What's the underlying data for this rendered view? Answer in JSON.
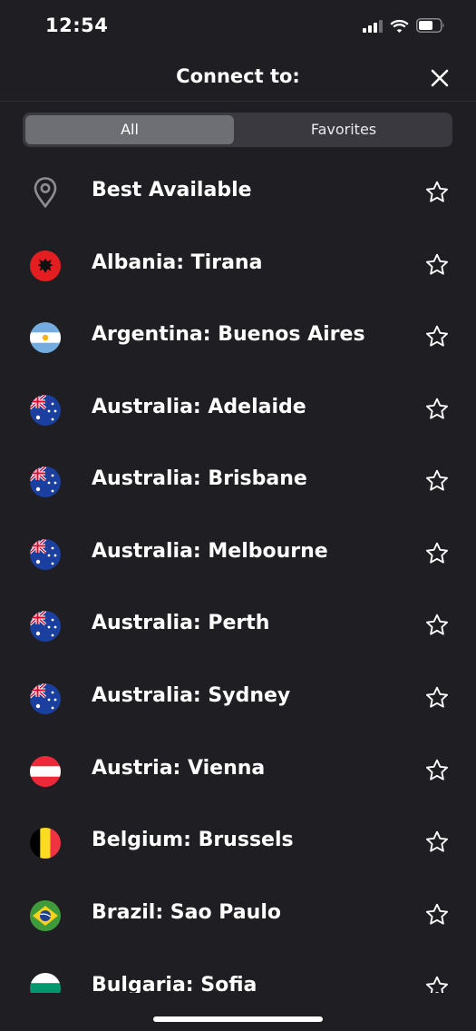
{
  "status_bar": {
    "time": "12:54",
    "icons": [
      "cellular-signal-icon",
      "wifi-icon",
      "battery-icon"
    ]
  },
  "header": {
    "title": "Connect to:",
    "close_icon": "close-icon"
  },
  "tabs": [
    {
      "label": "All",
      "selected": true
    },
    {
      "label": "Favorites",
      "selected": false
    }
  ],
  "colors": {
    "background": "#1f1e22",
    "segment_bg": "#3a393f",
    "segment_active": "#6e6f75",
    "text": "#ffffff"
  },
  "locations": [
    {
      "label": "Best Available",
      "icon": "location-pin-icon"
    },
    {
      "label": "Albania: Tirana",
      "icon": "albania-flag-icon"
    },
    {
      "label": "Argentina: Buenos Aires",
      "icon": "argentina-flag-icon"
    },
    {
      "label": "Australia: Adelaide",
      "icon": "australia-flag-icon"
    },
    {
      "label": "Australia: Brisbane",
      "icon": "australia-flag-icon"
    },
    {
      "label": "Australia: Melbourne",
      "icon": "australia-flag-icon"
    },
    {
      "label": "Australia: Perth",
      "icon": "australia-flag-icon"
    },
    {
      "label": "Australia: Sydney",
      "icon": "australia-flag-icon"
    },
    {
      "label": "Austria: Vienna",
      "icon": "austria-flag-icon"
    },
    {
      "label": "Belgium: Brussels",
      "icon": "belgium-flag-icon"
    },
    {
      "label": "Brazil: Sao Paulo",
      "icon": "brazil-flag-icon"
    },
    {
      "label": "Bulgaria: Sofia",
      "icon": "bulgaria-flag-icon"
    }
  ]
}
